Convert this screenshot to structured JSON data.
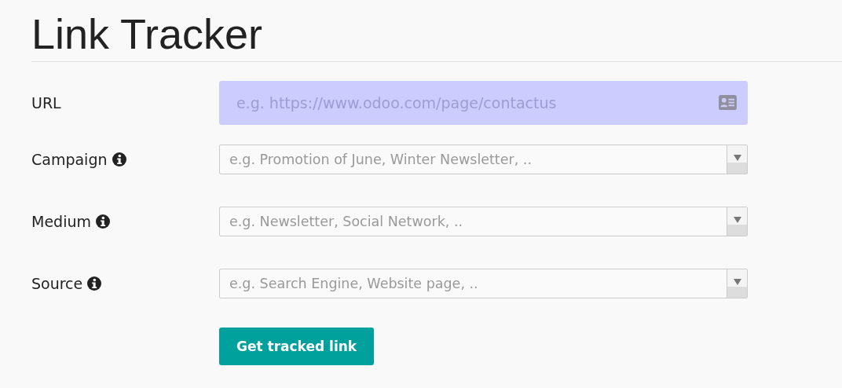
{
  "title": "Link Tracker",
  "fields": [
    {
      "label": "URL",
      "kind": "text",
      "required": true,
      "help": false,
      "placeholder": "e.g. https://www.odoo.com/page/contactus"
    },
    {
      "label": "Campaign",
      "kind": "select",
      "required": false,
      "help": true,
      "placeholder": "e.g. Promotion of June, Winter Newsletter, .."
    },
    {
      "label": "Medium",
      "kind": "select",
      "required": false,
      "help": true,
      "placeholder": "e.g. Newsletter, Social Network, .."
    },
    {
      "label": "Source",
      "kind": "select",
      "required": false,
      "help": true,
      "placeholder": "e.g. Search Engine, Website page, .."
    }
  ],
  "button": "Get tracked link"
}
